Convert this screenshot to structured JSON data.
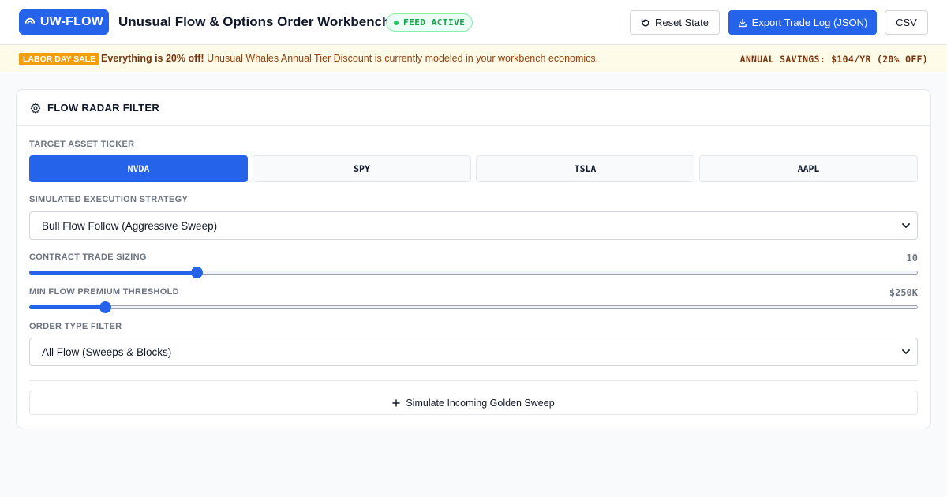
{
  "header": {
    "logo_text": "UW-FLOW",
    "title": "Unusual Flow & Options Order Workbench",
    "feed_status": "FEED ACTIVE",
    "reset_label": "Reset State",
    "export_label": "Export Trade Log (JSON)",
    "csv_label": "CSV"
  },
  "banner": {
    "tag": "LABOR DAY SALE",
    "headline": "Everything is 20% off!",
    "message": "Unusual Whales Annual Tier Discount is currently modeled in your workbench economics.",
    "savings": "ANNUAL SAVINGS: $104/YR (20% OFF)"
  },
  "panel": {
    "title": "FLOW RADAR FILTER",
    "ticker_label": "TARGET ASSET TICKER",
    "tickers": [
      "NVDA",
      "SPY",
      "TSLA",
      "AAPL"
    ],
    "selected_ticker": "NVDA",
    "strategy_label": "SIMULATED EXECUTION STRATEGY",
    "strategy_value": "Bull Flow Follow (Aggressive Sweep)",
    "sizing_label": "CONTRACT TRADE SIZING",
    "sizing_value": "10",
    "sizing_fraction": 0.188,
    "premium_label": "MIN FLOW PREMIUM THRESHOLD",
    "premium_value": "$250K",
    "premium_fraction": 0.085,
    "order_type_label": "ORDER TYPE FILTER",
    "order_type_value": "All Flow (Sweeps & Blocks)",
    "simulate_label": "Simulate Incoming Golden Sweep"
  },
  "colors": {
    "accent": "#2563eb",
    "feed_active": "#16a34a",
    "sale_tag": "#f59e0b"
  },
  "icons": {
    "logo": "signal-icon",
    "reset": "rotate-ccw-icon",
    "export": "download-icon",
    "panel": "gear-icon",
    "simulate": "plus-icon",
    "select": "chevron-down-icon"
  }
}
